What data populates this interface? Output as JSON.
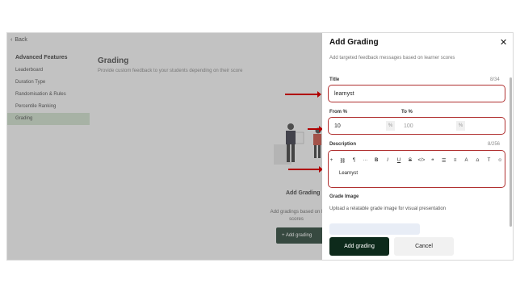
{
  "nav": {
    "back_label": "Back"
  },
  "sidebar": {
    "title": "Advanced Features",
    "items": [
      {
        "label": "Leaderboard"
      },
      {
        "label": "Duration Type"
      },
      {
        "label": "Randomisation & Rules"
      },
      {
        "label": "Percentile Ranking"
      },
      {
        "label": "Grading",
        "active": true
      }
    ]
  },
  "main": {
    "title": "Grading",
    "subtitle": "Provide custom feedback to your students depending on their score",
    "empty_title": "Add Grading",
    "empty_text_line1": "Add gradings based on l",
    "empty_text_line2": "scores",
    "add_button_label": "+ Add grading"
  },
  "drawer": {
    "title": "Add Grading",
    "subtitle": "Add targeted feedback messages based on learner scores",
    "title_label": "Title",
    "title_counter": "8/34",
    "title_value": "learnyst",
    "from_label": "From %",
    "to_label": "To %",
    "from_value": "10",
    "to_placeholder": "100",
    "percent_unit": "%",
    "description_label": "Description",
    "description_counter": "8/256",
    "description_value": "Learnyst",
    "toolbar_icons": [
      "+",
      "link-icon",
      "¶",
      "···",
      "B",
      "I",
      "U",
      "S",
      "</>",
      "quote-icon",
      "list-icon",
      "align-icon",
      "A",
      "highlight-icon",
      "T",
      "☺"
    ],
    "grade_image_label": "Grade Image",
    "grade_image_text": "Upload a relatable grade image for visual presentation",
    "submit_label": "Add grading",
    "cancel_label": "Cancel"
  },
  "colors": {
    "primary": "#0d2a1b",
    "highlight": "#b03030",
    "active_sidebar": "#c6d9c4"
  }
}
